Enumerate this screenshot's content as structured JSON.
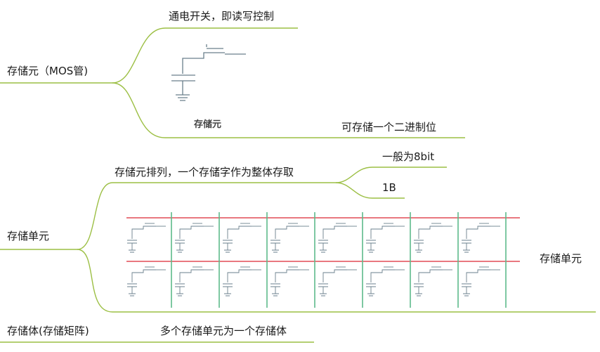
{
  "mindmap": {
    "node1": {
      "label": "存储元（MOS管)",
      "children": [
        "通电开关，即读写控制",
        "可存储一个二进制位"
      ],
      "figure_caption": "存储元"
    },
    "node2": {
      "label": "存储单元",
      "child": "存储元排列，一个存储字作为整体存取",
      "subchildren": [
        "一般为8bit",
        "1B"
      ],
      "figure_label": "存储单元"
    },
    "node3": {
      "label": "存储体(存储矩阵)",
      "child": "多个存储单元为一个存储体"
    }
  },
  "colors": {
    "branch": "#9cbf44",
    "red_line": "#e24b55",
    "green_line": "#5dbb8a",
    "circuit": "#6a7f8c"
  }
}
